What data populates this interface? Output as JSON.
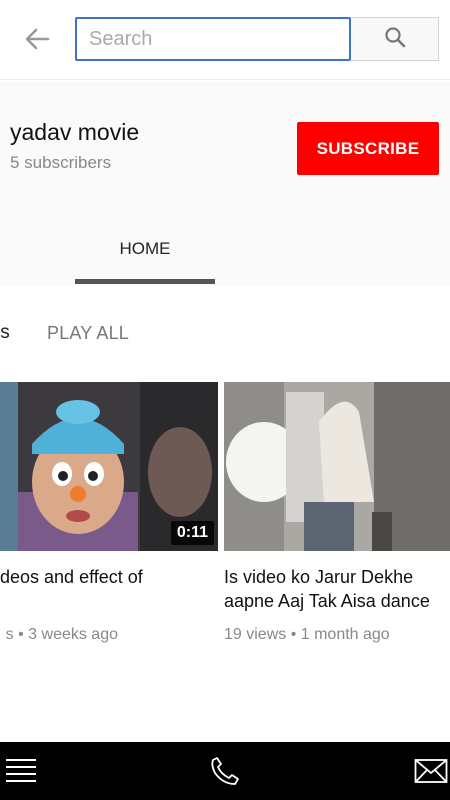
{
  "search": {
    "placeholder": "Search",
    "value": ""
  },
  "icons": {
    "back": "arrow-left-icon",
    "search": "search-icon",
    "menu": "menu-icon",
    "phone": "phone-icon",
    "mail": "mail-icon"
  },
  "channel": {
    "name": "yadav movie",
    "subscribers": "5 subscribers",
    "subscribe_label": "SUBSCRIBE"
  },
  "tabs": [
    {
      "label": "HOME",
      "selected": true
    }
  ],
  "section": {
    "title": "ls",
    "play_all_label": "PLAY ALL"
  },
  "videos": [
    {
      "title": "ideos and effect of",
      "meta": "s • 3 weeks ago",
      "duration": "0:11"
    },
    {
      "title": "Is video ko Jarur Dekhe aapne Aaj Tak Aisa dance",
      "meta": "19 views • 1 month ago",
      "duration": ""
    }
  ],
  "colors": {
    "accent": "#ff0000",
    "search_border": "#3b73c8",
    "bottom_bar": "#000000"
  }
}
